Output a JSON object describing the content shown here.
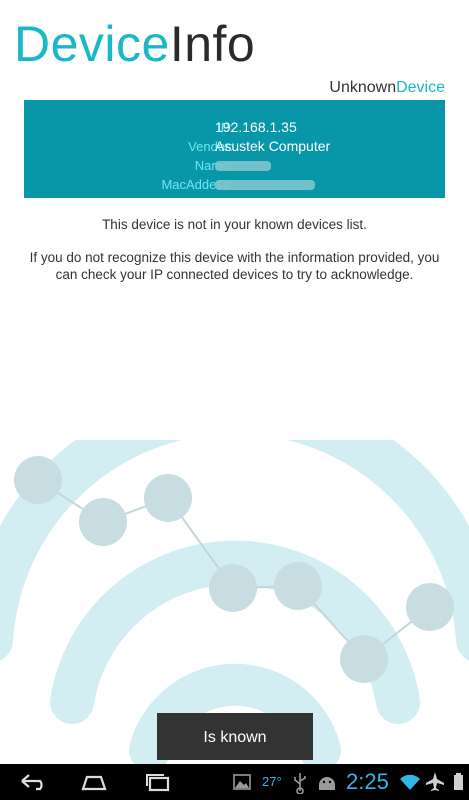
{
  "header": {
    "title_part1": "Device",
    "title_part2": "Info",
    "subtitle_part1": "Unknown",
    "subtitle_part2": "Device"
  },
  "info": {
    "ip_label": "IP:",
    "ip_value": "192.168.1.35",
    "vendor_label": "Vendor:",
    "vendor_value": "Asustek Computer",
    "name_label": "Name:",
    "mac_label": "MacAddess:"
  },
  "messages": {
    "not_known": "This device is not in your known devices list.",
    "recognize": "If you do not recognize this device with the information provided, you can check your IP connected devices to try to acknowledge."
  },
  "actions": {
    "is_known_label": "Is known"
  },
  "status_bar": {
    "temperature": "27°",
    "time": "2:25"
  },
  "colors": {
    "accent": "#1ab7c9",
    "panel": "#0897a8",
    "button": "#333333",
    "status": "#33b5e5"
  }
}
